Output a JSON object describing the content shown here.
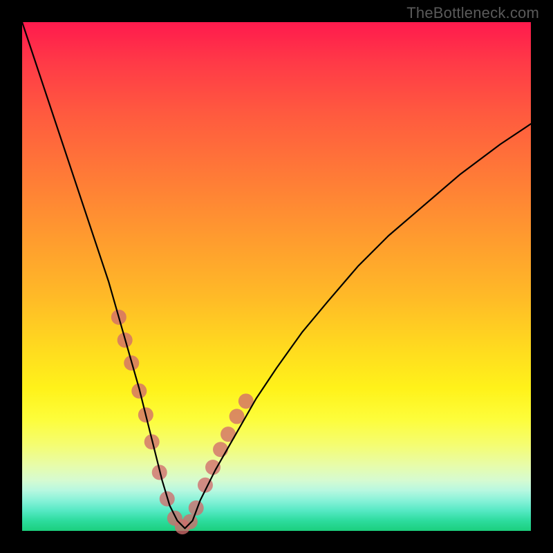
{
  "watermark": {
    "text": "TheBottleneck.com"
  },
  "chart_data": {
    "type": "line",
    "title": "",
    "xlabel": "",
    "ylabel": "",
    "xlim": [
      0,
      100
    ],
    "ylim": [
      0,
      100
    ],
    "series": [
      {
        "name": "bottleneck-curve",
        "x": [
          0,
          2,
          5,
          8,
          11,
          14,
          17,
          19,
          21,
          23,
          24.5,
          26,
          27.5,
          29,
          30.5,
          32,
          33.5,
          35,
          38,
          42,
          46,
          50,
          55,
          60,
          66,
          72,
          79,
          86,
          94,
          100
        ],
        "values": [
          100,
          94,
          85,
          76,
          67,
          58,
          49,
          42,
          35,
          28,
          22,
          16,
          10,
          5,
          2,
          0.5,
          2,
          6,
          12,
          19,
          26,
          32,
          39,
          45,
          52,
          58,
          64,
          70,
          76,
          80
        ]
      }
    ],
    "markers": {
      "name": "highlight-dots",
      "x": [
        19.0,
        20.2,
        21.5,
        23.0,
        24.3,
        25.5,
        27.0,
        28.5,
        30.0,
        31.5,
        33.0,
        34.2,
        36.0,
        37.5,
        39.0,
        40.5,
        42.2,
        44.0
      ],
      "values": [
        42.0,
        37.5,
        33.0,
        27.5,
        22.8,
        17.5,
        11.5,
        6.3,
        2.5,
        0.8,
        1.8,
        4.5,
        9.0,
        12.5,
        16.0,
        19.0,
        22.5,
        25.5
      ],
      "color": "#d16b6b",
      "radius": 11
    },
    "curve_color": "#000000",
    "curve_width": 2.2
  }
}
